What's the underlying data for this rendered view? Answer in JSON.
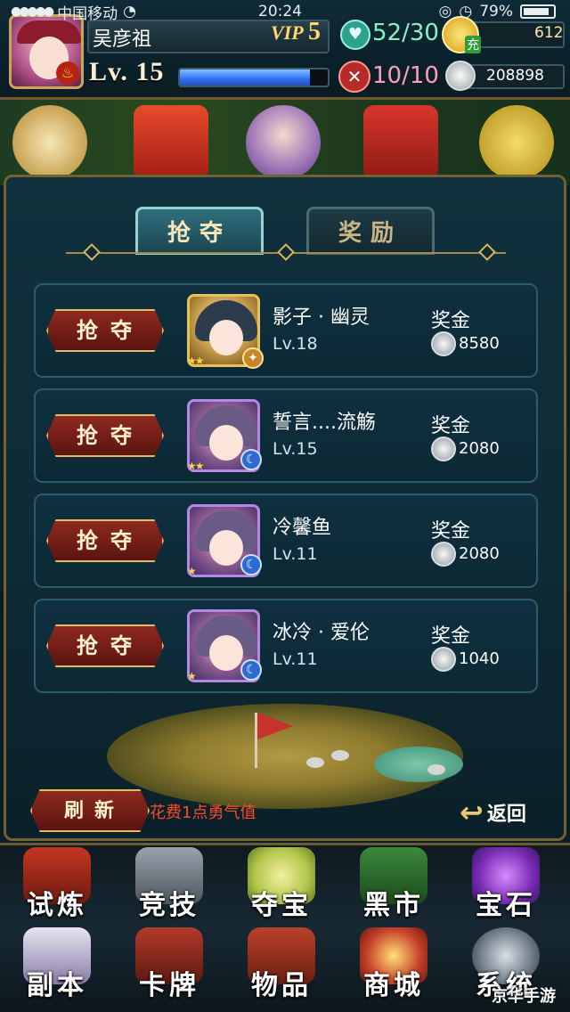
{
  "status_bar": {
    "carrier": "中国移动",
    "time": "20:24",
    "battery": "79%"
  },
  "player": {
    "name": "吴彦祖",
    "vip_label": "VIP",
    "vip_level": "5",
    "level": "Lv. 15",
    "xp_fraction": 0.88,
    "stamina": "52/30",
    "energy": "10/10",
    "charge_label": "充",
    "gems": "612",
    "coins": "208898"
  },
  "tabs": [
    {
      "label": "抢夺",
      "active": true
    },
    {
      "label": "奖励",
      "active": false
    }
  ],
  "targets": [
    {
      "button": "抢夺",
      "name": "影子 · 幽灵",
      "level": "Lv.18",
      "bounty_label": "奖金",
      "bounty": "8580",
      "stars": "★★",
      "frame": "gold"
    },
    {
      "button": "抢夺",
      "name": "誓言....流觞",
      "level": "Lv.15",
      "bounty_label": "奖金",
      "bounty": "2080",
      "stars": "★★",
      "frame": "purple"
    },
    {
      "button": "抢夺",
      "name": "冷馨鱼",
      "level": "Lv.11",
      "bounty_label": "奖金",
      "bounty": "2080",
      "stars": "★",
      "frame": "purple"
    },
    {
      "button": "抢夺",
      "name": "冰冷 · 爱伦",
      "level": "Lv.11",
      "bounty_label": "奖金",
      "bounty": "1040",
      "stars": "★",
      "frame": "purple"
    }
  ],
  "footer": {
    "refresh_label": "刷新",
    "refresh_cost": "花费1点勇气值",
    "return_label": "返回"
  },
  "nav": {
    "row1": [
      "试炼",
      "竞技",
      "夺宝",
      "黑市",
      "宝石"
    ],
    "row2": [
      "副本",
      "卡牌",
      "物品",
      "商城",
      "系统"
    ]
  },
  "watermark": "京华手游",
  "colors": {
    "panel_bg": "#0e2a35",
    "button_red": "#8e2a1e",
    "gold_trim": "#e5b968",
    "cost_text": "#ff4a2a"
  }
}
